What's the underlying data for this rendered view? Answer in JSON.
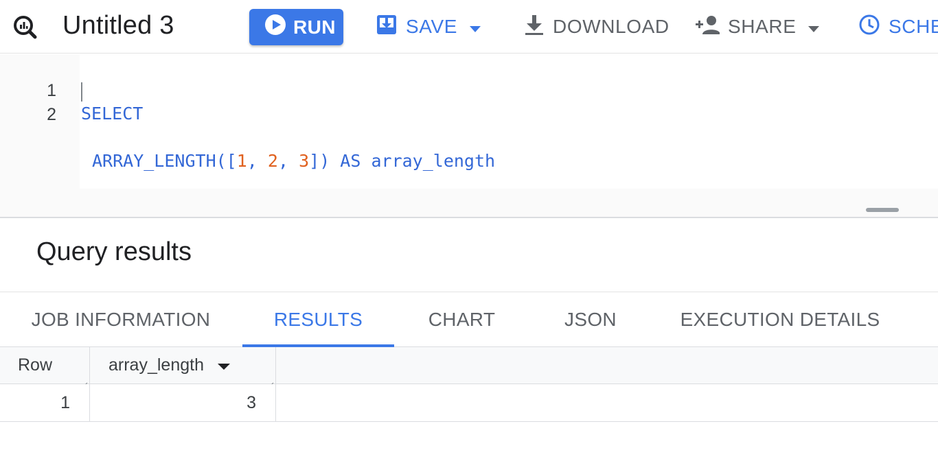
{
  "toolbar": {
    "title": "Untitled 3",
    "run_label": "RUN",
    "save_label": "SAVE",
    "download_label": "DOWNLOAD",
    "share_label": "SHARE",
    "schedule_label": "SCHE",
    "icons": [
      "query-icon",
      "play-icon",
      "save-icon",
      "download-icon",
      "add-person-icon",
      "clock-icon",
      "chevron-down-icon"
    ]
  },
  "editor": {
    "lines": [
      {
        "number": "1",
        "text": "SELECT"
      },
      {
        "number": "2",
        "text": "ARRAY_LENGTH([1, 2, 3]) AS array_length"
      }
    ],
    "tokens": {
      "fn": "ARRAY_LENGTH",
      "open": "([",
      "n1": "1",
      "comma1": ", ",
      "n2": "2",
      "comma2": ", ",
      "n3": "3",
      "close": "])",
      "as_kw": " AS ",
      "alias": "array_length"
    }
  },
  "results": {
    "title": "Query results",
    "tabs": [
      {
        "label": "JOB INFORMATION",
        "active": false
      },
      {
        "label": "RESULTS",
        "active": true
      },
      {
        "label": "CHART",
        "active": false
      },
      {
        "label": "JSON",
        "active": false
      },
      {
        "label": "EXECUTION DETAILS",
        "active": false
      }
    ],
    "columns": [
      "Row",
      "array_length"
    ],
    "rows": [
      {
        "row": "1",
        "array_length": "3"
      }
    ]
  },
  "colors": {
    "accent": "#3b78e7",
    "keyword": "#3367d6",
    "number": "#e0611f",
    "muted": "#5f6368"
  }
}
